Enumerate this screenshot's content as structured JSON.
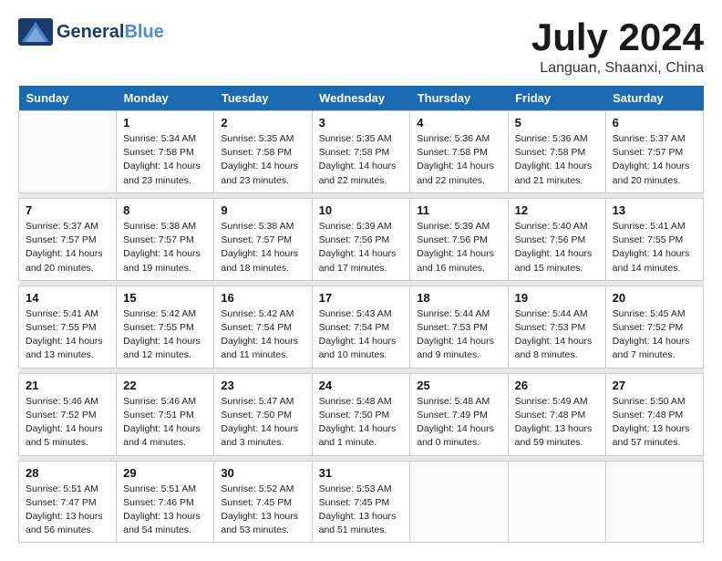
{
  "header": {
    "logo_line1": "General",
    "logo_line2": "Blue",
    "month": "July 2024",
    "location": "Languan, Shaanxi, China"
  },
  "weekdays": [
    "Sunday",
    "Monday",
    "Tuesday",
    "Wednesday",
    "Thursday",
    "Friday",
    "Saturday"
  ],
  "weeks": [
    [
      {
        "day": "",
        "info": ""
      },
      {
        "day": "1",
        "info": "Sunrise: 5:34 AM\nSunset: 7:58 PM\nDaylight: 14 hours\nand 23 minutes."
      },
      {
        "day": "2",
        "info": "Sunrise: 5:35 AM\nSunset: 7:58 PM\nDaylight: 14 hours\nand 23 minutes."
      },
      {
        "day": "3",
        "info": "Sunrise: 5:35 AM\nSunset: 7:58 PM\nDaylight: 14 hours\nand 22 minutes."
      },
      {
        "day": "4",
        "info": "Sunrise: 5:36 AM\nSunset: 7:58 PM\nDaylight: 14 hours\nand 22 minutes."
      },
      {
        "day": "5",
        "info": "Sunrise: 5:36 AM\nSunset: 7:58 PM\nDaylight: 14 hours\nand 21 minutes."
      },
      {
        "day": "6",
        "info": "Sunrise: 5:37 AM\nSunset: 7:57 PM\nDaylight: 14 hours\nand 20 minutes."
      }
    ],
    [
      {
        "day": "7",
        "info": "Sunrise: 5:37 AM\nSunset: 7:57 PM\nDaylight: 14 hours\nand 20 minutes."
      },
      {
        "day": "8",
        "info": "Sunrise: 5:38 AM\nSunset: 7:57 PM\nDaylight: 14 hours\nand 19 minutes."
      },
      {
        "day": "9",
        "info": "Sunrise: 5:38 AM\nSunset: 7:57 PM\nDaylight: 14 hours\nand 18 minutes."
      },
      {
        "day": "10",
        "info": "Sunrise: 5:39 AM\nSunset: 7:56 PM\nDaylight: 14 hours\nand 17 minutes."
      },
      {
        "day": "11",
        "info": "Sunrise: 5:39 AM\nSunset: 7:56 PM\nDaylight: 14 hours\nand 16 minutes."
      },
      {
        "day": "12",
        "info": "Sunrise: 5:40 AM\nSunset: 7:56 PM\nDaylight: 14 hours\nand 15 minutes."
      },
      {
        "day": "13",
        "info": "Sunrise: 5:41 AM\nSunset: 7:55 PM\nDaylight: 14 hours\nand 14 minutes."
      }
    ],
    [
      {
        "day": "14",
        "info": "Sunrise: 5:41 AM\nSunset: 7:55 PM\nDaylight: 14 hours\nand 13 minutes."
      },
      {
        "day": "15",
        "info": "Sunrise: 5:42 AM\nSunset: 7:55 PM\nDaylight: 14 hours\nand 12 minutes."
      },
      {
        "day": "16",
        "info": "Sunrise: 5:42 AM\nSunset: 7:54 PM\nDaylight: 14 hours\nand 11 minutes."
      },
      {
        "day": "17",
        "info": "Sunrise: 5:43 AM\nSunset: 7:54 PM\nDaylight: 14 hours\nand 10 minutes."
      },
      {
        "day": "18",
        "info": "Sunrise: 5:44 AM\nSunset: 7:53 PM\nDaylight: 14 hours\nand 9 minutes."
      },
      {
        "day": "19",
        "info": "Sunrise: 5:44 AM\nSunset: 7:53 PM\nDaylight: 14 hours\nand 8 minutes."
      },
      {
        "day": "20",
        "info": "Sunrise: 5:45 AM\nSunset: 7:52 PM\nDaylight: 14 hours\nand 7 minutes."
      }
    ],
    [
      {
        "day": "21",
        "info": "Sunrise: 5:46 AM\nSunset: 7:52 PM\nDaylight: 14 hours\nand 5 minutes."
      },
      {
        "day": "22",
        "info": "Sunrise: 5:46 AM\nSunset: 7:51 PM\nDaylight: 14 hours\nand 4 minutes."
      },
      {
        "day": "23",
        "info": "Sunrise: 5:47 AM\nSunset: 7:50 PM\nDaylight: 14 hours\nand 3 minutes."
      },
      {
        "day": "24",
        "info": "Sunrise: 5:48 AM\nSunset: 7:50 PM\nDaylight: 14 hours\nand 1 minute."
      },
      {
        "day": "25",
        "info": "Sunrise: 5:48 AM\nSunset: 7:49 PM\nDaylight: 14 hours\nand 0 minutes."
      },
      {
        "day": "26",
        "info": "Sunrise: 5:49 AM\nSunset: 7:48 PM\nDaylight: 13 hours\nand 59 minutes."
      },
      {
        "day": "27",
        "info": "Sunrise: 5:50 AM\nSunset: 7:48 PM\nDaylight: 13 hours\nand 57 minutes."
      }
    ],
    [
      {
        "day": "28",
        "info": "Sunrise: 5:51 AM\nSunset: 7:47 PM\nDaylight: 13 hours\nand 56 minutes."
      },
      {
        "day": "29",
        "info": "Sunrise: 5:51 AM\nSunset: 7:46 PM\nDaylight: 13 hours\nand 54 minutes."
      },
      {
        "day": "30",
        "info": "Sunrise: 5:52 AM\nSunset: 7:45 PM\nDaylight: 13 hours\nand 53 minutes."
      },
      {
        "day": "31",
        "info": "Sunrise: 5:53 AM\nSunset: 7:45 PM\nDaylight: 13 hours\nand 51 minutes."
      },
      {
        "day": "",
        "info": ""
      },
      {
        "day": "",
        "info": ""
      },
      {
        "day": "",
        "info": ""
      }
    ]
  ]
}
